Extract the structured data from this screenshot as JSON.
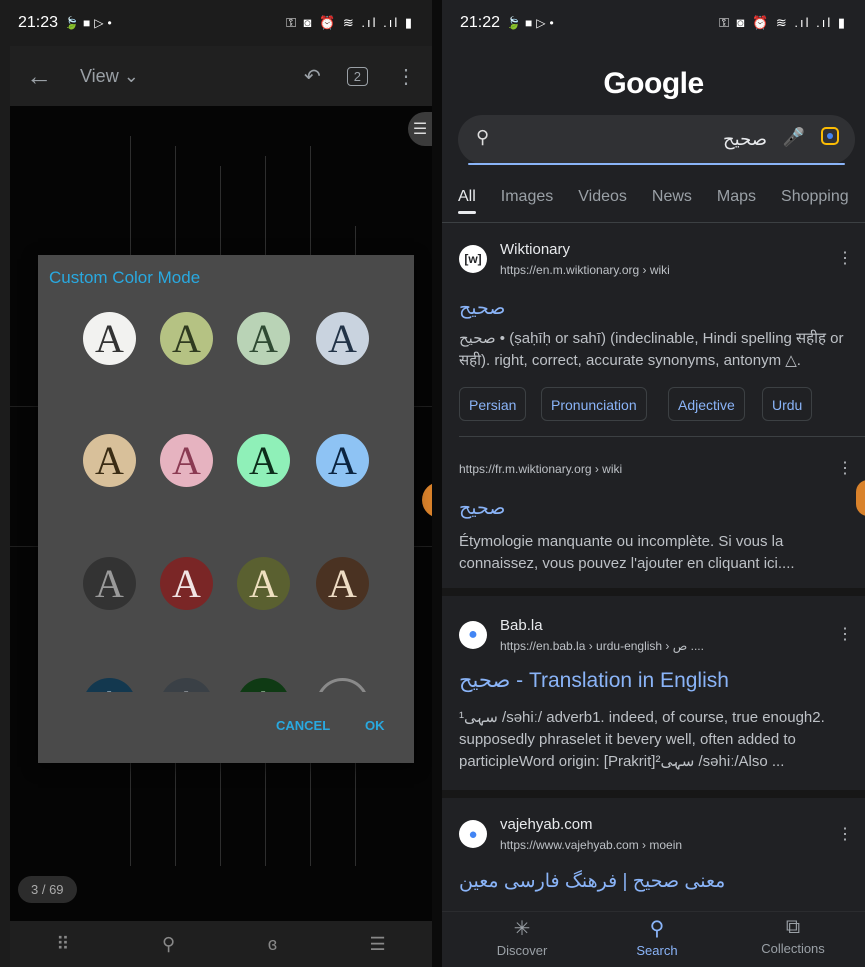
{
  "left": {
    "status_time": "21:23",
    "appbar": {
      "view_label": "View",
      "pages_count": "2"
    },
    "page_indicator": "3 / 69",
    "dialog": {
      "title": "Custom Color Mode",
      "swatch_letter": "A",
      "cancel": "CANCEL",
      "ok": "OK",
      "swatches": [
        {
          "bg": "#f2f2f0",
          "fg": "#333333"
        },
        {
          "bg": "#b5c283",
          "fg": "#2f3a20"
        },
        {
          "bg": "#b9d3b6",
          "fg": "#2f4a33"
        },
        {
          "bg": "#c9d3df",
          "fg": "#223347"
        },
        {
          "bg": "#d8c09a",
          "fg": "#3a2c14"
        },
        {
          "bg": "#e6b3c0",
          "fg": "#8a3a52"
        },
        {
          "bg": "#8ff0b8",
          "fg": "#0c2d1b"
        },
        {
          "bg": "#8ec3f4",
          "fg": "#0b2440"
        },
        {
          "bg": "#333333",
          "fg": "#9a9a9a"
        },
        {
          "bg": "#7a2626",
          "fg": "#f2e4e4"
        },
        {
          "bg": "#5a6030",
          "fg": "#eedfbf"
        },
        {
          "bg": "#4a3222",
          "fg": "#eedcc4"
        },
        {
          "bg": "#13384f",
          "fg": "#d6e8f4"
        },
        {
          "bg": "#3a4046",
          "fg": "#c4c9cf"
        },
        {
          "bg": "#0f3a14",
          "fg": "#d8f0d8"
        },
        {
          "bg": "#4a4a4a",
          "fg": "#8a8a8a"
        }
      ]
    }
  },
  "right": {
    "status_time": "21:22",
    "logo": "Google",
    "query": "صحيح",
    "tabs": [
      "All",
      "Images",
      "Videos",
      "News",
      "Maps",
      "Shopping"
    ],
    "results": [
      {
        "site": "Wiktionary",
        "favicon": "[w]",
        "url": "https://en.m.wiktionary.org › wiki",
        "title": "صحيح",
        "snippet": "صحيح • (ṣaḥīḥ or sahī) (indeclinable, Hindi spelling सहीह or सही). right, correct, accurate synonyms, antonym △.",
        "chips": [
          "Persian",
          "Pronunciation",
          "Adjective",
          "Urdu"
        ]
      },
      {
        "url": "https://fr.m.wiktionary.org › wiki",
        "title": "صحيح",
        "snippet": "Étymologie manquante ou incomplète. Si vous la connaissez, vous pouvez l'ajouter en cliquant ici...."
      },
      {
        "site": "Bab.la",
        "url": "https://en.bab.la › urdu-english › ص ....",
        "title": "صحيح - Translation in English",
        "snippet": "سہی¹ /səhiː/ adverb1. indeed, of course, true enough2. supposedly phraselet it bevery well, often added to participleWord origin: [Prakrit]سہی² /səhiː/Also ..."
      },
      {
        "site": "vajehyab.com",
        "url": "https://www.vajehyab.com › moein",
        "title": "معنی صحیح | فرهنگ فارسی معین"
      }
    ],
    "bottom_nav": [
      "Discover",
      "Search",
      "Collections"
    ]
  }
}
